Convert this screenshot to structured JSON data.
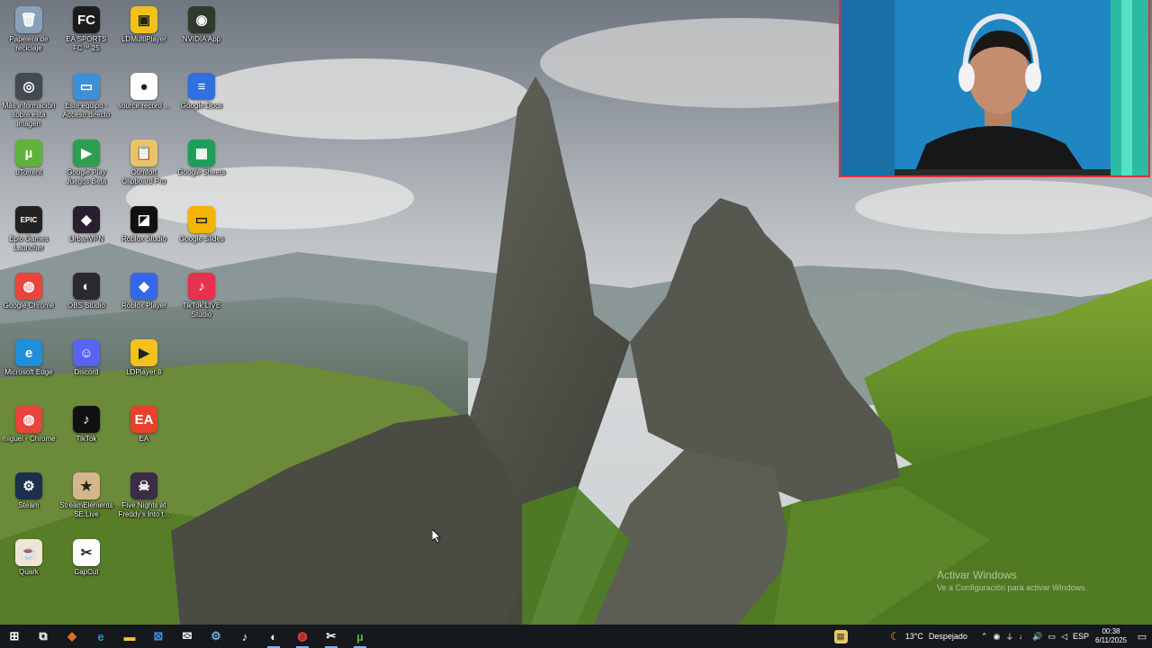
{
  "desktop": {
    "icons": [
      {
        "label": "Papelera de reciclaje",
        "icon": "recycle-bin-icon",
        "color": "#8aa0b8",
        "glyph": "🗑"
      },
      {
        "label": "EA SPORTS FC™ 25",
        "icon": "ea-fc-icon",
        "color": "#1c1c1c",
        "glyph": "FC"
      },
      {
        "label": "LDMultiPlayer",
        "icon": "ldmultiplayer-icon",
        "color": "#f2c21b",
        "glyph": "▣"
      },
      {
        "label": "NVIDIA App",
        "icon": "nvidia-icon",
        "color": "#2f3a2c",
        "glyph": "◉"
      },
      {
        "label": "Más información sobre esta imagen",
        "icon": "info-camera-icon",
        "color": "#444a52",
        "glyph": "◎"
      },
      {
        "label": "Este equipo - Acceso directo",
        "icon": "computer-icon",
        "color": "#3d8fd6",
        "glyph": "▭"
      },
      {
        "label": "source record ...",
        "icon": "record-icon",
        "color": "#ffffff",
        "glyph": "●"
      },
      {
        "label": "Google Docs",
        "icon": "google-docs-icon",
        "color": "#2f6fe0",
        "glyph": "≡"
      },
      {
        "label": "uTorrent",
        "icon": "utorrent-icon",
        "color": "#5fb23c",
        "glyph": "µ"
      },
      {
        "label": "Google Play Juegos Beta",
        "icon": "google-play-games-icon",
        "color": "#2d9e4f",
        "glyph": "▶"
      },
      {
        "label": "Comfort Clipboard Pro",
        "icon": "clipboard-icon",
        "color": "#e7c46a",
        "glyph": "📋"
      },
      {
        "label": "Google Sheets",
        "icon": "google-sheets-icon",
        "color": "#1e9e57",
        "glyph": "▦"
      },
      {
        "label": "Epic Games Launcher",
        "icon": "epic-games-icon",
        "color": "#222222",
        "glyph": "EPIC"
      },
      {
        "label": "UrbanVPN",
        "icon": "urbanvpn-icon",
        "color": "#2a1f2f",
        "glyph": "◆"
      },
      {
        "label": "Roblox Studio",
        "icon": "roblox-studio-icon",
        "color": "#111111",
        "glyph": "◪"
      },
      {
        "label": "Google Slides",
        "icon": "google-slides-icon",
        "color": "#f4b400",
        "glyph": "▭"
      },
      {
        "label": "Google Chrome",
        "icon": "chrome-icon",
        "color": "#e8453c",
        "glyph": "◍"
      },
      {
        "label": "OBS Studio",
        "icon": "obs-icon",
        "color": "#2a2a2e",
        "glyph": "◐"
      },
      {
        "label": "Roblox Player",
        "icon": "roblox-player-icon",
        "color": "#3568e8",
        "glyph": "◆"
      },
      {
        "label": "TikTok LIVE Studio",
        "icon": "tiktok-live-icon",
        "color": "#e8304f",
        "glyph": "♪"
      },
      {
        "label": "Microsoft Edge",
        "icon": "edge-icon",
        "color": "#1f8fd8",
        "glyph": "e"
      },
      {
        "label": "Discord",
        "icon": "discord-icon",
        "color": "#5865f2",
        "glyph": "☺"
      },
      {
        "label": "LDPlayer 9",
        "icon": "ldplayer-icon",
        "color": "#f2c21b",
        "glyph": "▶"
      },
      {
        "label": "miguel - Chrome",
        "icon": "chrome-profile-icon",
        "color": "#e8453c",
        "glyph": "◍"
      },
      {
        "label": "TikTok",
        "icon": "tiktok-icon",
        "color": "#111111",
        "glyph": "♪"
      },
      {
        "label": "EA",
        "icon": "ea-icon",
        "color": "#e9412c",
        "glyph": "EA"
      },
      {
        "label": "Steam",
        "icon": "steam-icon",
        "color": "#1b2f4e",
        "glyph": "⚙"
      },
      {
        "label": "StreamElements SE.Live",
        "icon": "streamelements-icon",
        "color": "#d4b68c",
        "glyph": "★"
      },
      {
        "label": "Five Nights at Freddy's Into t...",
        "icon": "fnaf-icon",
        "color": "#3b2c48",
        "glyph": "☠"
      },
      {
        "label": "Quark",
        "icon": "quark-icon",
        "color": "#f0e6d8",
        "glyph": "☕"
      },
      {
        "label": "CapCut",
        "icon": "capcut-icon",
        "color": "#ffffff",
        "glyph": "✂"
      }
    ]
  },
  "watermark": {
    "line1": "Activar Windows",
    "line2": "Ve a Configuración para activar Windows."
  },
  "taskbar": {
    "pinned": [
      {
        "icon": "windows-start-icon",
        "glyph": "⊞",
        "color": "#ffffff",
        "active": false
      },
      {
        "icon": "task-view-icon",
        "glyph": "⧉",
        "color": "#ffffff",
        "active": false
      },
      {
        "icon": "copilot-icon",
        "glyph": "◆",
        "color": "#e0702a",
        "active": false
      },
      {
        "icon": "edge-taskbar-icon",
        "glyph": "e",
        "color": "#1f8fd8",
        "active": false
      },
      {
        "icon": "file-explorer-icon",
        "glyph": "▬",
        "color": "#f2c244",
        "active": false
      },
      {
        "icon": "store-icon",
        "glyph": "⊠",
        "color": "#3b8fe0",
        "active": false
      },
      {
        "icon": "mail-icon",
        "glyph": "✉",
        "color": "#ffffff",
        "active": false
      },
      {
        "icon": "steam-taskbar-icon",
        "glyph": "⚙",
        "color": "#6fa8dc",
        "active": false
      },
      {
        "icon": "tiktok-taskbar-icon",
        "glyph": "♪",
        "color": "#ffffff",
        "active": false
      },
      {
        "icon": "obs-taskbar-icon",
        "glyph": "◐",
        "color": "#ffffff",
        "active": true
      },
      {
        "icon": "chrome-taskbar-icon",
        "glyph": "◍",
        "color": "#e8453c",
        "active": true
      },
      {
        "icon": "capcut-taskbar-icon",
        "glyph": "✂",
        "color": "#ffffff",
        "active": true
      },
      {
        "icon": "utorrent-taskbar-icon",
        "glyph": "µ",
        "color": "#5fb23c",
        "active": true
      }
    ],
    "tray": {
      "weather_temp": "13°C",
      "weather_desc": "Despejado",
      "language": "ESP",
      "time": "00:38",
      "date": "6/11/2025"
    }
  }
}
